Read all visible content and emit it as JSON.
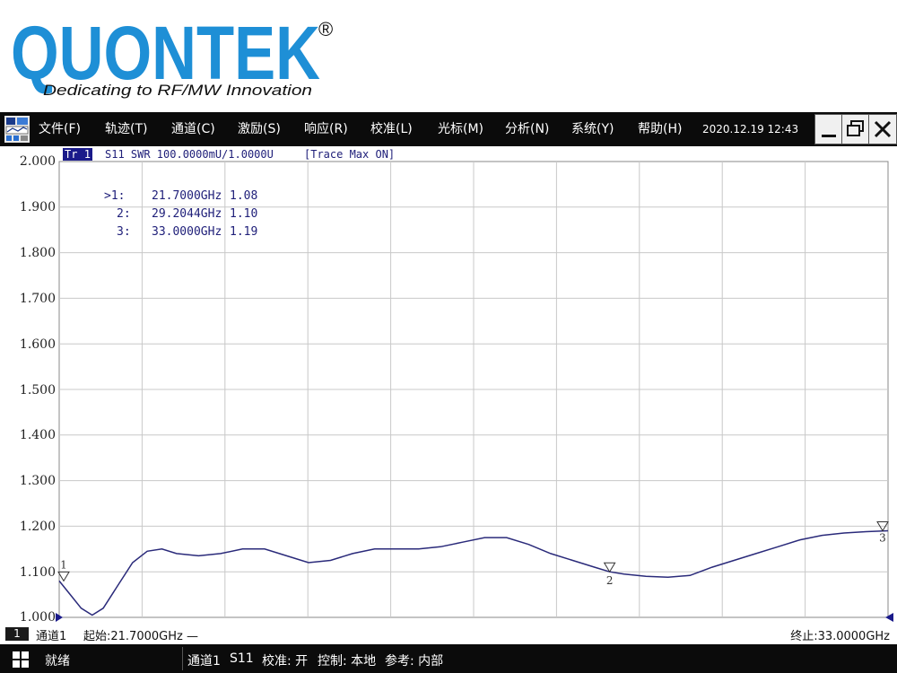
{
  "logo": {
    "brand": "QUONTEK",
    "registered": "®",
    "tagline": "Dedicating to RF/MW Innovation"
  },
  "menubar": {
    "items": [
      "文件(F)",
      "轨迹(T)",
      "通道(C)",
      "激励(S)",
      "响应(R)",
      "校准(L)",
      "光标(M)",
      "分析(N)",
      "系统(Y)",
      "帮助(H)"
    ],
    "datetime": "2020.12.19 12:43"
  },
  "trace": {
    "tag": "Tr 1",
    "info": "S11 SWR 100.0000mU/1.0000U",
    "mode": "[Trace Max ON]"
  },
  "axis": {
    "y_ticks": [
      "2.000",
      "1.900",
      "1.800",
      "1.700",
      "1.600",
      "1.500",
      "1.400",
      "1.300",
      "1.200",
      "1.100",
      "1.000"
    ]
  },
  "markers": [
    {
      "label": ">1:",
      "freq": "21.7000GHz",
      "value": "1.08"
    },
    {
      "label": "2:",
      "freq": "29.2044GHz",
      "value": "1.10"
    },
    {
      "label": "3:",
      "freq": "33.0000GHz",
      "value": "1.19"
    }
  ],
  "marker_flags": [
    "1",
    "2",
    "3"
  ],
  "channel": {
    "number": "1",
    "name": "通道1",
    "start": "起始:21.7000GHz —",
    "stop": "终止:33.0000GHz"
  },
  "status": {
    "ready": "就绪",
    "items": [
      "通道1",
      "S11",
      "校准: 开",
      "控制: 本地",
      "参考: 内部"
    ]
  },
  "colors": {
    "trace": "#2a2a7a",
    "grid": "#c8c8c8",
    "menubar_bg": "#0b0b0b",
    "logo_blue": "#1e8fd6"
  },
  "chart_data": {
    "type": "line",
    "xlabel": "",
    "ylabel": "",
    "xlim": [
      21.7,
      33.0
    ],
    "ylim": [
      1.0,
      2.0
    ],
    "grid": true,
    "series": [
      {
        "x": [
          21.7,
          21.85,
          22.0,
          22.15,
          22.3,
          22.5,
          22.7,
          22.9,
          23.1,
          23.3,
          23.6,
          23.9,
          24.2,
          24.5,
          24.8,
          25.1,
          25.4,
          25.7,
          26.0,
          26.3,
          26.6,
          26.9,
          27.2,
          27.5,
          27.8,
          28.1,
          28.4,
          28.7,
          29.0,
          29.2044,
          29.4,
          29.7,
          30.0,
          30.3,
          30.6,
          30.9,
          31.2,
          31.5,
          31.8,
          32.1,
          32.4,
          32.7,
          33.0
        ],
        "y": [
          1.08,
          1.05,
          1.02,
          1.005,
          1.02,
          1.07,
          1.12,
          1.145,
          1.15,
          1.14,
          1.135,
          1.14,
          1.15,
          1.15,
          1.135,
          1.12,
          1.125,
          1.14,
          1.15,
          1.15,
          1.15,
          1.155,
          1.165,
          1.175,
          1.175,
          1.16,
          1.14,
          1.125,
          1.11,
          1.1,
          1.095,
          1.09,
          1.088,
          1.092,
          1.11,
          1.125,
          1.14,
          1.155,
          1.17,
          1.18,
          1.185,
          1.188,
          1.19
        ]
      }
    ]
  }
}
